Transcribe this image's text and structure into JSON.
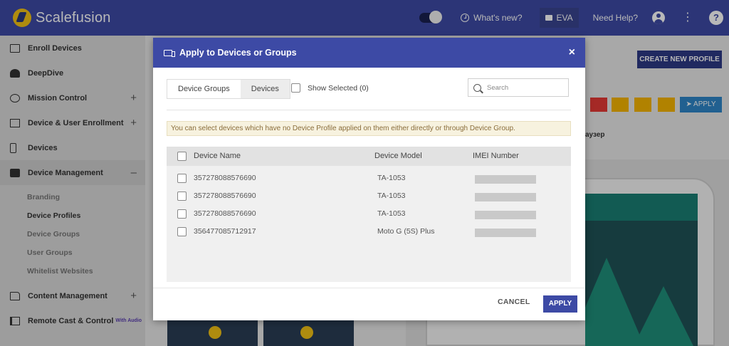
{
  "app": {
    "brand": "Scalefusion"
  },
  "topbar": {
    "whats_new": "What's new?",
    "user_badge": "EVA",
    "help": "Need Help?",
    "more": "⋮",
    "question": "?"
  },
  "sidebar": {
    "items": [
      {
        "label": "Enroll Devices",
        "icon": "enroll-icon",
        "expand": ""
      },
      {
        "label": "DeepDive",
        "icon": "deepdive-icon",
        "expand": ""
      },
      {
        "label": "Mission Control",
        "icon": "mission-control-icon",
        "expand": "+"
      },
      {
        "label": "Device & User Enrollment",
        "icon": "device-user-icon",
        "expand": "+"
      },
      {
        "label": "Devices",
        "icon": "device-icon",
        "expand": ""
      },
      {
        "label": "Device Management",
        "icon": "briefcase-icon",
        "expand": "–"
      },
      {
        "label": "Content Management",
        "icon": "folder-icon",
        "expand": "+"
      },
      {
        "label": "Remote Cast & Control",
        "icon": "cast-icon",
        "expand": "",
        "tag": "With Audio"
      }
    ],
    "subitems": [
      "Branding",
      "Device Profiles",
      "Device Groups",
      "User Groups",
      "Whitelist Websites"
    ]
  },
  "background": {
    "create_profile": "CREATE NEW PROFILE",
    "apply": "➤ APPLY",
    "partial_text": "аузер",
    "colors": {
      "accent": "#3d4aa5",
      "delete": "#e53935",
      "warning": "#f5b400"
    }
  },
  "modal": {
    "title": "Apply to Devices or Groups",
    "close": "×",
    "tabs": [
      "Device Groups",
      "Devices"
    ],
    "show_selected": "Show Selected (0)",
    "search_placeholder": "Search",
    "info": "You can select devices which have no Device Profile applied on them either directly or through Device Group.",
    "columns": [
      "Device Name",
      "Device Model",
      "IMEI Number"
    ],
    "rows": [
      {
        "name": "357278088576690",
        "model": "TA-1053"
      },
      {
        "name": "357278088576690",
        "model": "TA-1053"
      },
      {
        "name": "357278088576690",
        "model": "TA-1053"
      },
      {
        "name": "356477085712917",
        "model": "Moto G (5S) Plus"
      }
    ],
    "cancel": "CANCEL",
    "apply": "APPLY"
  }
}
